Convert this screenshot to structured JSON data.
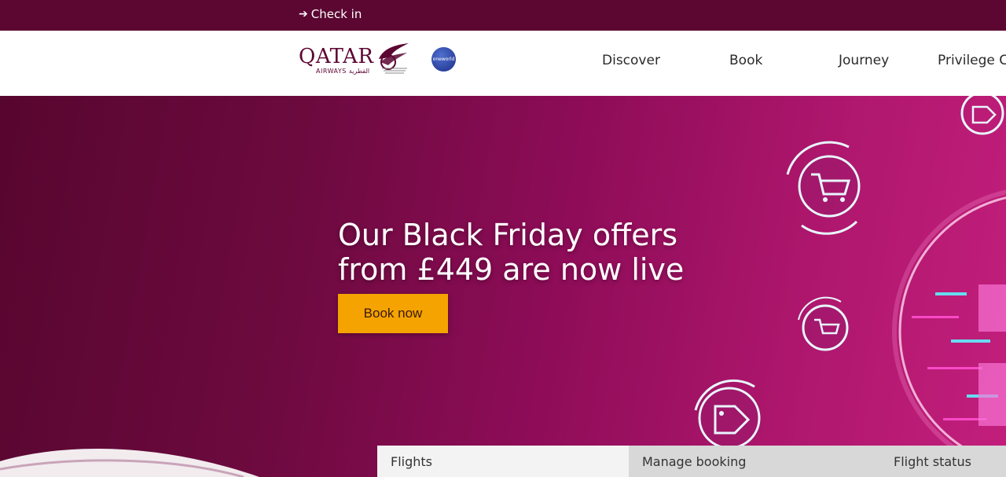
{
  "topbar": {
    "checkin_label": "Check in"
  },
  "header": {
    "logo_text": "QATAR",
    "logo_sub": "AIRWAYS القطرية",
    "alliance_badge": "oneworld",
    "nav": [
      "Discover",
      "Book",
      "Journey",
      "Privilege Cl"
    ]
  },
  "hero": {
    "title_line1": "Our Black Friday offers",
    "title_line2": "from £449 are now live",
    "cta_label": "Book now"
  },
  "booking_tabs": [
    "Flights",
    "Manage booking",
    "Flight status"
  ],
  "colors": {
    "brand": "#5c0632",
    "accent": "#f5a300",
    "hero_end": "#c21f7c"
  },
  "icons": [
    "arrow-right-icon",
    "shopping-cart-icon",
    "price-tag-icon"
  ]
}
